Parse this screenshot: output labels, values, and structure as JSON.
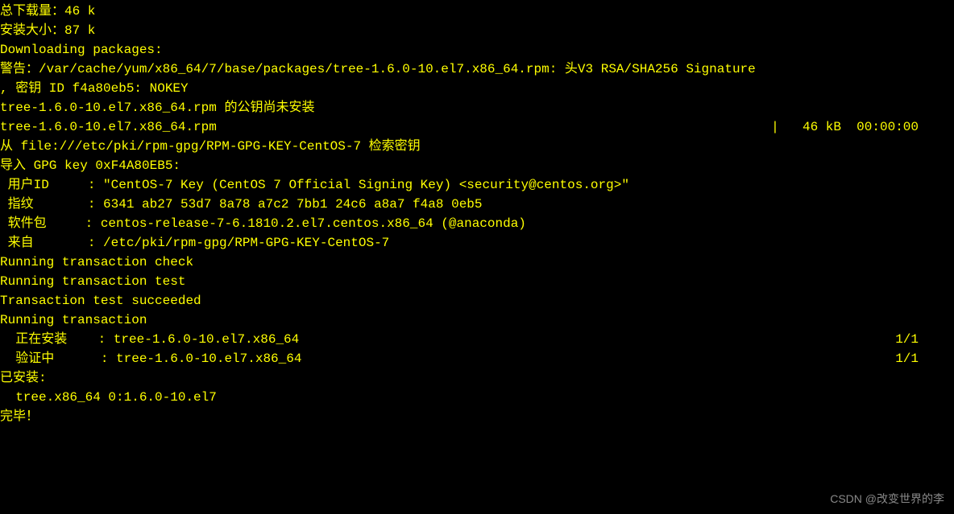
{
  "lines": {
    "total_download": "总下载量：46 k",
    "install_size": "安装大小：87 k",
    "downloading": "Downloading packages:",
    "warning_line1": "警告：/var/cache/yum/x86_64/7/base/packages/tree-1.6.0-10.el7.x86_64.rpm: 头V3 RSA/SHA256 Signature",
    "warning_line2": ", 密钥 ID f4a80eb5: NOKEY",
    "pubkey_not_installed": "tree-1.6.0-10.el7.x86_64.rpm 的公钥尚未安装",
    "rpm_name": "tree-1.6.0-10.el7.x86_64.rpm",
    "progress_pipe": "|  ",
    "progress_info": "46 kB  00:00:00",
    "retrieve_key": "从 file:///etc/pki/rpm-gpg/RPM-GPG-KEY-CentOS-7 检索密钥",
    "import_gpg": "导入 GPG key 0xF4A80EB5:",
    "user_id": " 用户ID     : \"CentOS-7 Key (CentOS 7 Official Signing Key) <security@centos.org>\"",
    "fingerprint": " 指纹       : 6341 ab27 53d7 8a78 a7c2 7bb1 24c6 a8a7 f4a8 0eb5",
    "package": " 软件包     : centos-release-7-6.1810.2.el7.centos.x86_64 (@anaconda)",
    "from": " 来自       : /etc/pki/rpm-gpg/RPM-GPG-KEY-CentOS-7",
    "trans_check": "Running transaction check",
    "trans_test": "Running transaction test",
    "trans_succeeded": "Transaction test succeeded",
    "running_trans": "Running transaction",
    "installing_left": "  正在安装    : tree-1.6.0-10.el7.x86_64",
    "installing_right": "1/1",
    "verifying_left": "  验证中      : tree-1.6.0-10.el7.x86_64",
    "verifying_right": "1/1",
    "blank": "",
    "installed_header": "已安装:",
    "installed_pkg": "  tree.x86_64 0:1.6.0-10.el7",
    "complete": "完毕！"
  },
  "watermark": "CSDN @改变世界的李"
}
